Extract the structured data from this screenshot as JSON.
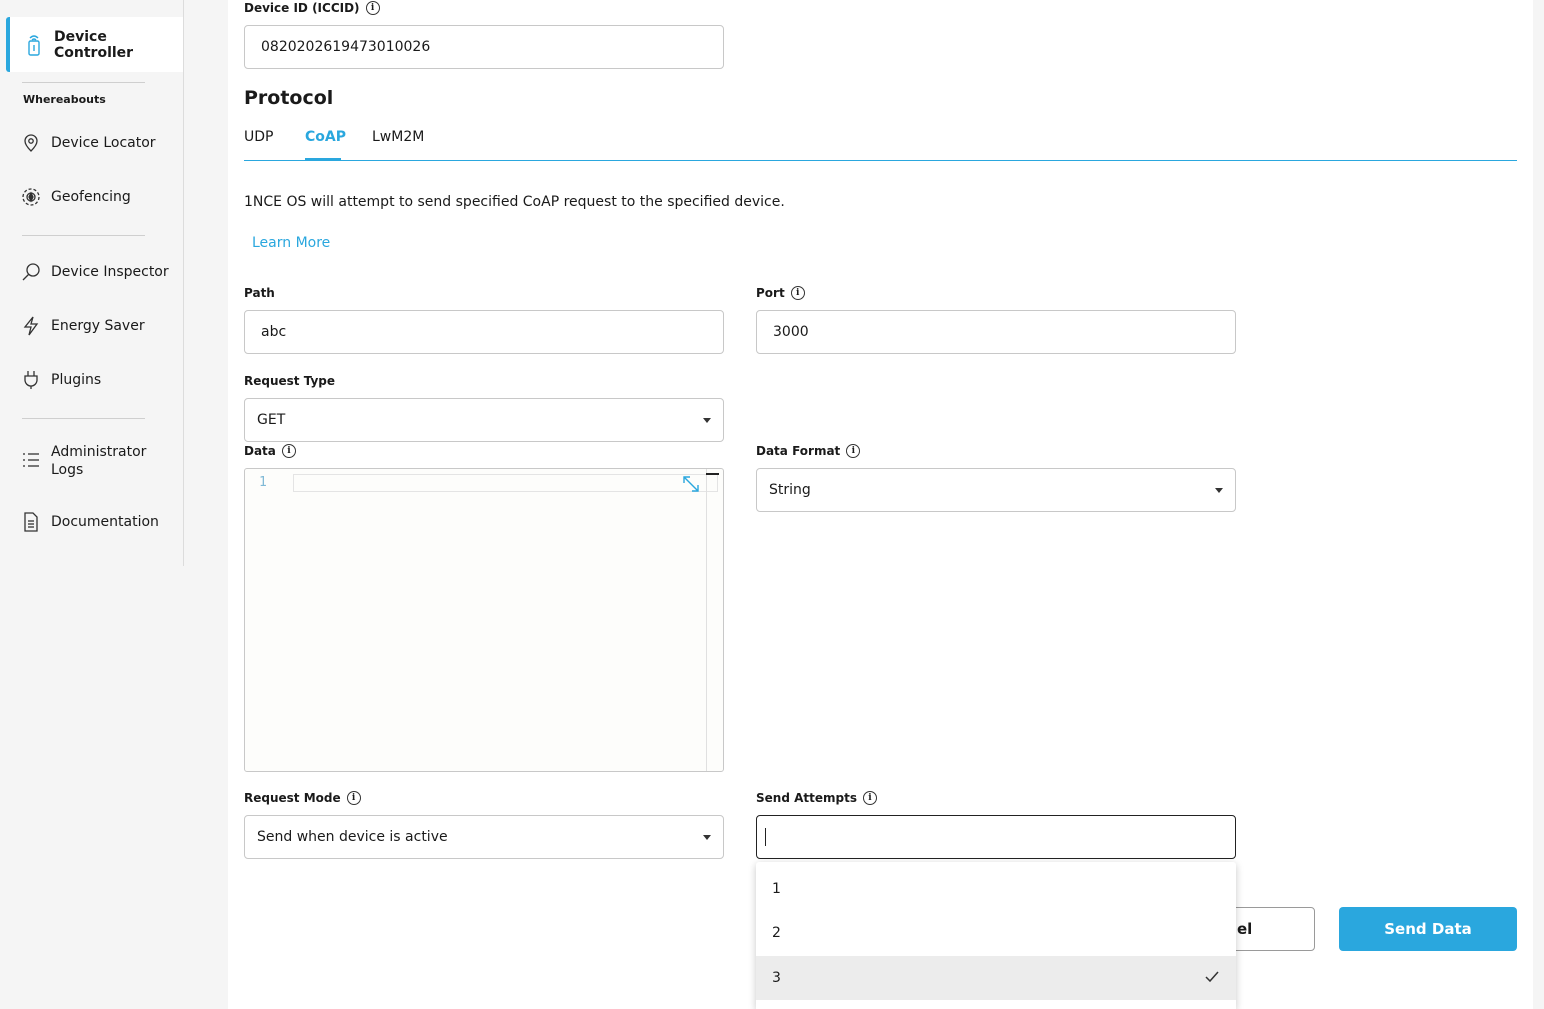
{
  "sidebar": {
    "active_item": "Device Controller",
    "section_whereabouts": "Whereabouts",
    "items": [
      {
        "label": "Device Locator",
        "icon": "map-pin-icon"
      },
      {
        "label": "Geofencing",
        "icon": "geofence-icon"
      },
      {
        "label": "Device Inspector",
        "icon": "magnifier-icon"
      },
      {
        "label": "Energy Saver",
        "icon": "lightning-icon"
      },
      {
        "label": "Plugins",
        "icon": "plug-icon"
      },
      {
        "label": "Administrator Logs",
        "icon": "list-icon"
      },
      {
        "label": "Documentation",
        "icon": "document-icon"
      }
    ]
  },
  "form": {
    "device_id_label": "Device ID (ICCID)",
    "device_id_value": "0820202619473010026",
    "protocol_heading": "Protocol",
    "tabs": [
      "UDP",
      "CoAP",
      "LwM2M"
    ],
    "active_tab": "CoAP",
    "description": "1NCE OS will attempt to send specified CoAP request to the specified device.",
    "learn_more": "Learn More",
    "path_label": "Path",
    "path_value": "abc",
    "port_label": "Port",
    "port_value": "3000",
    "request_type_label": "Request Type",
    "request_type_value": "GET",
    "data_label": "Data",
    "data_line_number": "1",
    "data_format_label": "Data Format",
    "data_format_value": "String",
    "request_mode_label": "Request Mode",
    "request_mode_value": "Send when device is active",
    "send_attempts_label": "Send Attempts",
    "send_attempts_value": "",
    "send_attempts_options": [
      "1",
      "2",
      "3"
    ],
    "send_attempts_selected": "3"
  },
  "buttons": {
    "cancel_visible_text": "el",
    "send": "Send Data"
  },
  "colors": {
    "accent": "#2aa7de",
    "sidebar_bg": "#f5f5f5",
    "selected_option_bg": "#ececec"
  }
}
